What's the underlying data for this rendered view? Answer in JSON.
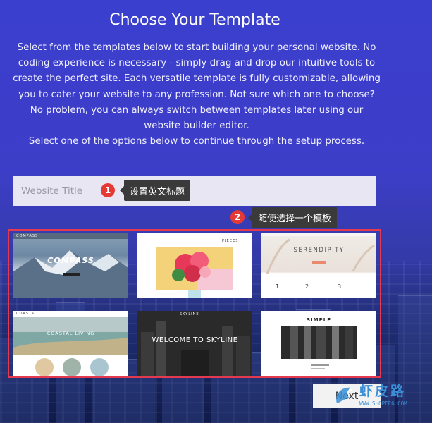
{
  "header": {
    "title": "Choose Your Template",
    "description_lines": [
      "Select from the templates below to start building your personal website. No",
      "coding experience is necessary - simply drag and drop our intuitive tools to",
      "create the perfect site. Each versatile template is fully customizable, allowing",
      "you to cater your website to any profession. Not sure which one to choose?",
      "No problem, you can always switch between templates later using our",
      "website builder editor.",
      "Select one of the options below to continue through the setup process."
    ]
  },
  "website_title_input": {
    "placeholder": "Website Title",
    "value": ""
  },
  "annotations": [
    {
      "number": "1",
      "text": "设置英文标题"
    },
    {
      "number": "2",
      "text": "随便选择一个模板"
    }
  ],
  "templates": [
    {
      "name": "COMPASS",
      "logo": "COMPASS"
    },
    {
      "name": "PIECES",
      "logo": "PIECES"
    },
    {
      "name": "SERENDIPITY",
      "logo": "SERENDIPITY",
      "steps": [
        "1.",
        "2.",
        "3."
      ]
    },
    {
      "name": "COASTAL",
      "logo": "COASTAL",
      "hero": "COASTAL LIVING"
    },
    {
      "name": "SKYLINE",
      "logo": "SKYLINE",
      "hero": "WELCOME TO SKYLINE"
    },
    {
      "name": "SIMPLE",
      "logo": "SIMPLE"
    }
  ],
  "actions": {
    "next_label": "Next"
  },
  "watermark": {
    "text": "虾皮路",
    "url": "WWW.SHOPEE6.COM"
  },
  "colors": {
    "accent_red": "#e53950",
    "badge_red": "#e53935",
    "tooltip_bg": "#3a3a3a",
    "input_bg": "#e9e6f4",
    "bg_top": "#3b3fce",
    "bg_bottom": "#1f2a62"
  }
}
